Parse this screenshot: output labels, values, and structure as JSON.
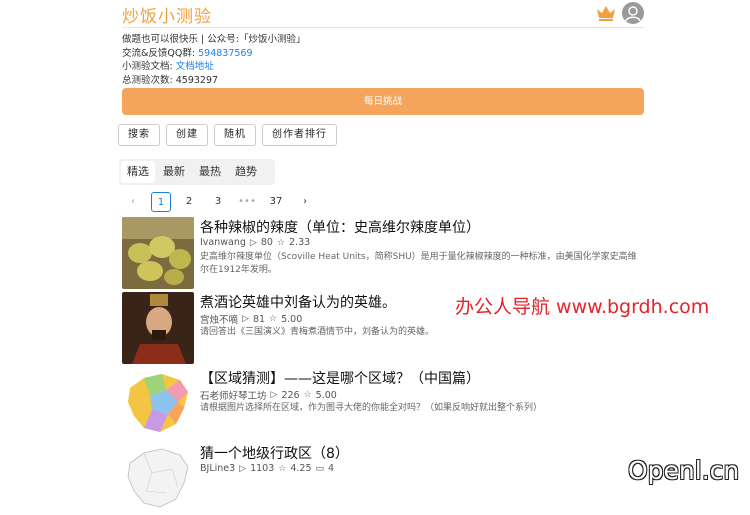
{
  "header": {
    "logo": "炒饭小测验"
  },
  "info": {
    "line1": "做题也可以很快乐 | 公众号:「炒饭小测验」",
    "qq_label": "交流&反馈QQ群:",
    "qq_value": "594837569",
    "docs_label": "小测验文档:",
    "docs_link": "文档地址",
    "count_label": "总测验次数:",
    "count_value": "4593297"
  },
  "daily_button": "每日挑战",
  "actions": [
    "搜索",
    "创建",
    "随机",
    "创作者排行"
  ],
  "tabs": [
    "精选",
    "最新",
    "最热",
    "趋势"
  ],
  "pagination": {
    "pages": [
      "1",
      "2",
      "3",
      "•••",
      "37"
    ],
    "current": "1"
  },
  "quizzes": [
    {
      "title": "各种辣椒的辣度（单位：史高维尔辣度单位）",
      "author": "Ivanwang",
      "plays": "80",
      "rating": "2.33",
      "desc": "史高维尔辣度单位（Scoville Heat Units，简称SHU）是用于量化辣椒辣度的一种标准，由美国化学家史高维尔在1912年发明。"
    },
    {
      "title": "煮酒论英雄中刘备认为的英雄。",
      "author": "宫烛不嘀",
      "plays": "81",
      "rating": "5.00",
      "desc": "请回答出《三国演义》青梅煮酒情节中，刘备认为的英雄。"
    },
    {
      "title": "【区域猜测】——这是哪个区域？（中国篇）",
      "author": "石老师好琴工坊",
      "plays": "226",
      "rating": "5.00",
      "desc": "请根据图片选择所在区域，作为图寻大佬的你能全对吗？（如果反响好就出整个系列）"
    },
    {
      "title": "猜一个地级行政区（8）",
      "author": "BJLine3",
      "plays": "1103",
      "rating": "4.25",
      "comments": "4",
      "desc": ""
    }
  ],
  "watermarks": {
    "site": "办公人导航 www.bgrdh.com",
    "brand": "Openl.cn"
  },
  "colors": {
    "brand": "#f0a23c",
    "daily": "#f5a55b",
    "link": "#1e7ee8",
    "watermark_red": "#e2242b"
  }
}
